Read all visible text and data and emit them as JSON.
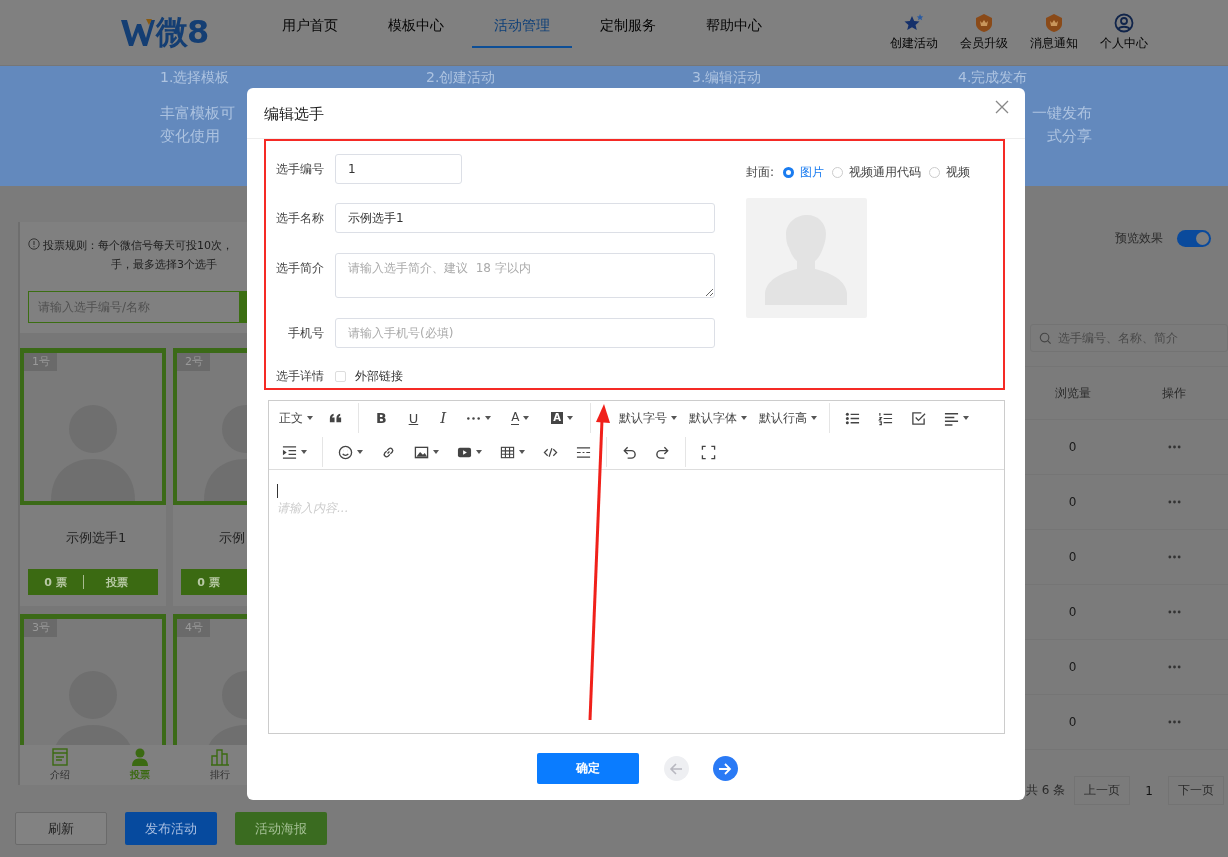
{
  "header": {
    "logo": "微8",
    "nav": [
      {
        "label": "用户首页",
        "selected": false
      },
      {
        "label": "模板中心",
        "selected": false
      },
      {
        "label": "活动管理",
        "selected": true
      },
      {
        "label": "定制服务",
        "selected": false
      },
      {
        "label": "帮助中心",
        "selected": false
      }
    ],
    "actions": [
      {
        "kind": "star",
        "label": "创建活动"
      },
      {
        "kind": "medal",
        "label": "会员升级"
      },
      {
        "kind": "medal",
        "label": "消息通知"
      },
      {
        "kind": "user",
        "label": "个人中心"
      }
    ]
  },
  "banner": {
    "steps": [
      {
        "title": "1.选择模板",
        "lines": [
          "丰富模板可",
          "变化使用"
        ]
      },
      {
        "title": "2.创建活动"
      },
      {
        "title": "3.编辑活动"
      },
      {
        "title": "4.完成发布",
        "lines": [
          "一键发布",
          "式分享"
        ]
      }
    ]
  },
  "voting": {
    "rules": [
      "投票规则：每个微信号每天可投10次，",
      "手，最多选择3个选手"
    ],
    "search_placeholder": "请输入选手编号/名称",
    "contestants": [
      {
        "number": "1号",
        "name": "示例选手1",
        "votes": "0 票",
        "vote_button": "投票"
      },
      {
        "number": "2号",
        "name": "示例",
        "votes": "0 票"
      },
      {
        "number": "3号"
      },
      {
        "number": "4号"
      }
    ],
    "tabs": [
      {
        "label": "介绍",
        "kind": "intro",
        "selected": false
      },
      {
        "label": "投票",
        "kind": "vote",
        "selected": true
      },
      {
        "label": "排行",
        "kind": "rank",
        "selected": false
      }
    ]
  },
  "preview": {
    "label": "预览效果",
    "on": true
  },
  "table": {
    "search_placeholder": "选手编号、名称、简介",
    "columns": [
      "浏览量",
      "操作"
    ],
    "rows": [
      {
        "views": "0"
      },
      {
        "views": "0"
      },
      {
        "views": "0"
      },
      {
        "views": "0"
      },
      {
        "views": "0"
      },
      {
        "views": "0"
      }
    ]
  },
  "pagination": {
    "total": "共 6 条",
    "prev": "上一页",
    "page": "1",
    "next": "下一页"
  },
  "buttons": [
    {
      "label": "刷新",
      "kind": "default"
    },
    {
      "label": "发布活动",
      "kind": "primary"
    },
    {
      "label": "活动海报",
      "kind": "success"
    }
  ],
  "dialog": {
    "title": "编辑选手",
    "fields": [
      {
        "label": "选手编号",
        "value": "1",
        "kind": "short"
      },
      {
        "label": "选手名称",
        "value": "示例选手1",
        "kind": "text"
      },
      {
        "label": "选手简介",
        "placeholder": "请输入选手简介、建议  18 字以内",
        "kind": "textarea"
      },
      {
        "label": "手机号",
        "placeholder": "请输入手机号(必填)",
        "kind": "text"
      }
    ],
    "detail": {
      "label": "选手详情",
      "option": "外部链接",
      "checked": false
    },
    "cover": {
      "label": "封面:",
      "options": [
        {
          "label": "图片",
          "selected": true
        },
        {
          "label": "视频通用代码",
          "selected": false
        },
        {
          "label": "视频",
          "selected": false
        }
      ]
    },
    "editor": {
      "toolbar": [
        [
          [
            {
              "kind": "select",
              "label": "正文",
              "dropdown": true
            },
            {
              "kind": "quote",
              "dropdown": false
            }
          ],
          [
            {
              "kind": "bold",
              "label": "B",
              "dropdown": false
            },
            {
              "kind": "underline",
              "label": "U",
              "dropdown": false
            },
            {
              "kind": "italic",
              "label": "I",
              "dropdown": false
            },
            {
              "kind": "more",
              "dropdown": true
            },
            {
              "kind": "font-color",
              "label": "A",
              "dropdown": true
            },
            {
              "kind": "back-color",
              "label": "A",
              "dropdown": true
            }
          ],
          [
            {
              "kind": "select",
              "label": "默认字号",
              "dropdown": true
            },
            {
              "kind": "select",
              "label": "默认字体",
              "dropdown": true
            },
            {
              "kind": "select",
              "label": "默认行高",
              "dropdown": true
            }
          ],
          [
            {
              "kind": "bullet-list",
              "dropdown": false
            },
            {
              "kind": "numbered-list",
              "dropdown": false
            },
            {
              "kind": "todo",
              "dropdown": false
            },
            {
              "kind": "align",
              "dropdown": true
            }
          ]
        ],
        [
          [
            {
              "kind": "indent",
              "dropdown": true
            }
          ],
          [
            {
              "kind": "emoji",
              "dropdown": true
            },
            {
              "kind": "link",
              "dropdown": false
            },
            {
              "kind": "image",
              "dropdown": true
            },
            {
              "kind": "video",
              "dropdown": true
            },
            {
              "kind": "table",
              "dropdown": true
            },
            {
              "kind": "code",
              "dropdown": false
            },
            {
              "kind": "divider",
              "dropdown": false
            }
          ],
          [
            {
              "kind": "undo",
              "dropdown": false
            },
            {
              "kind": "redo",
              "dropdown": false
            }
          ],
          [
            {
              "kind": "fullscreen",
              "dropdown": false
            }
          ]
        ]
      ],
      "placeholder": "请输入内容..."
    },
    "confirm": "确定",
    "prev_disabled": true
  }
}
